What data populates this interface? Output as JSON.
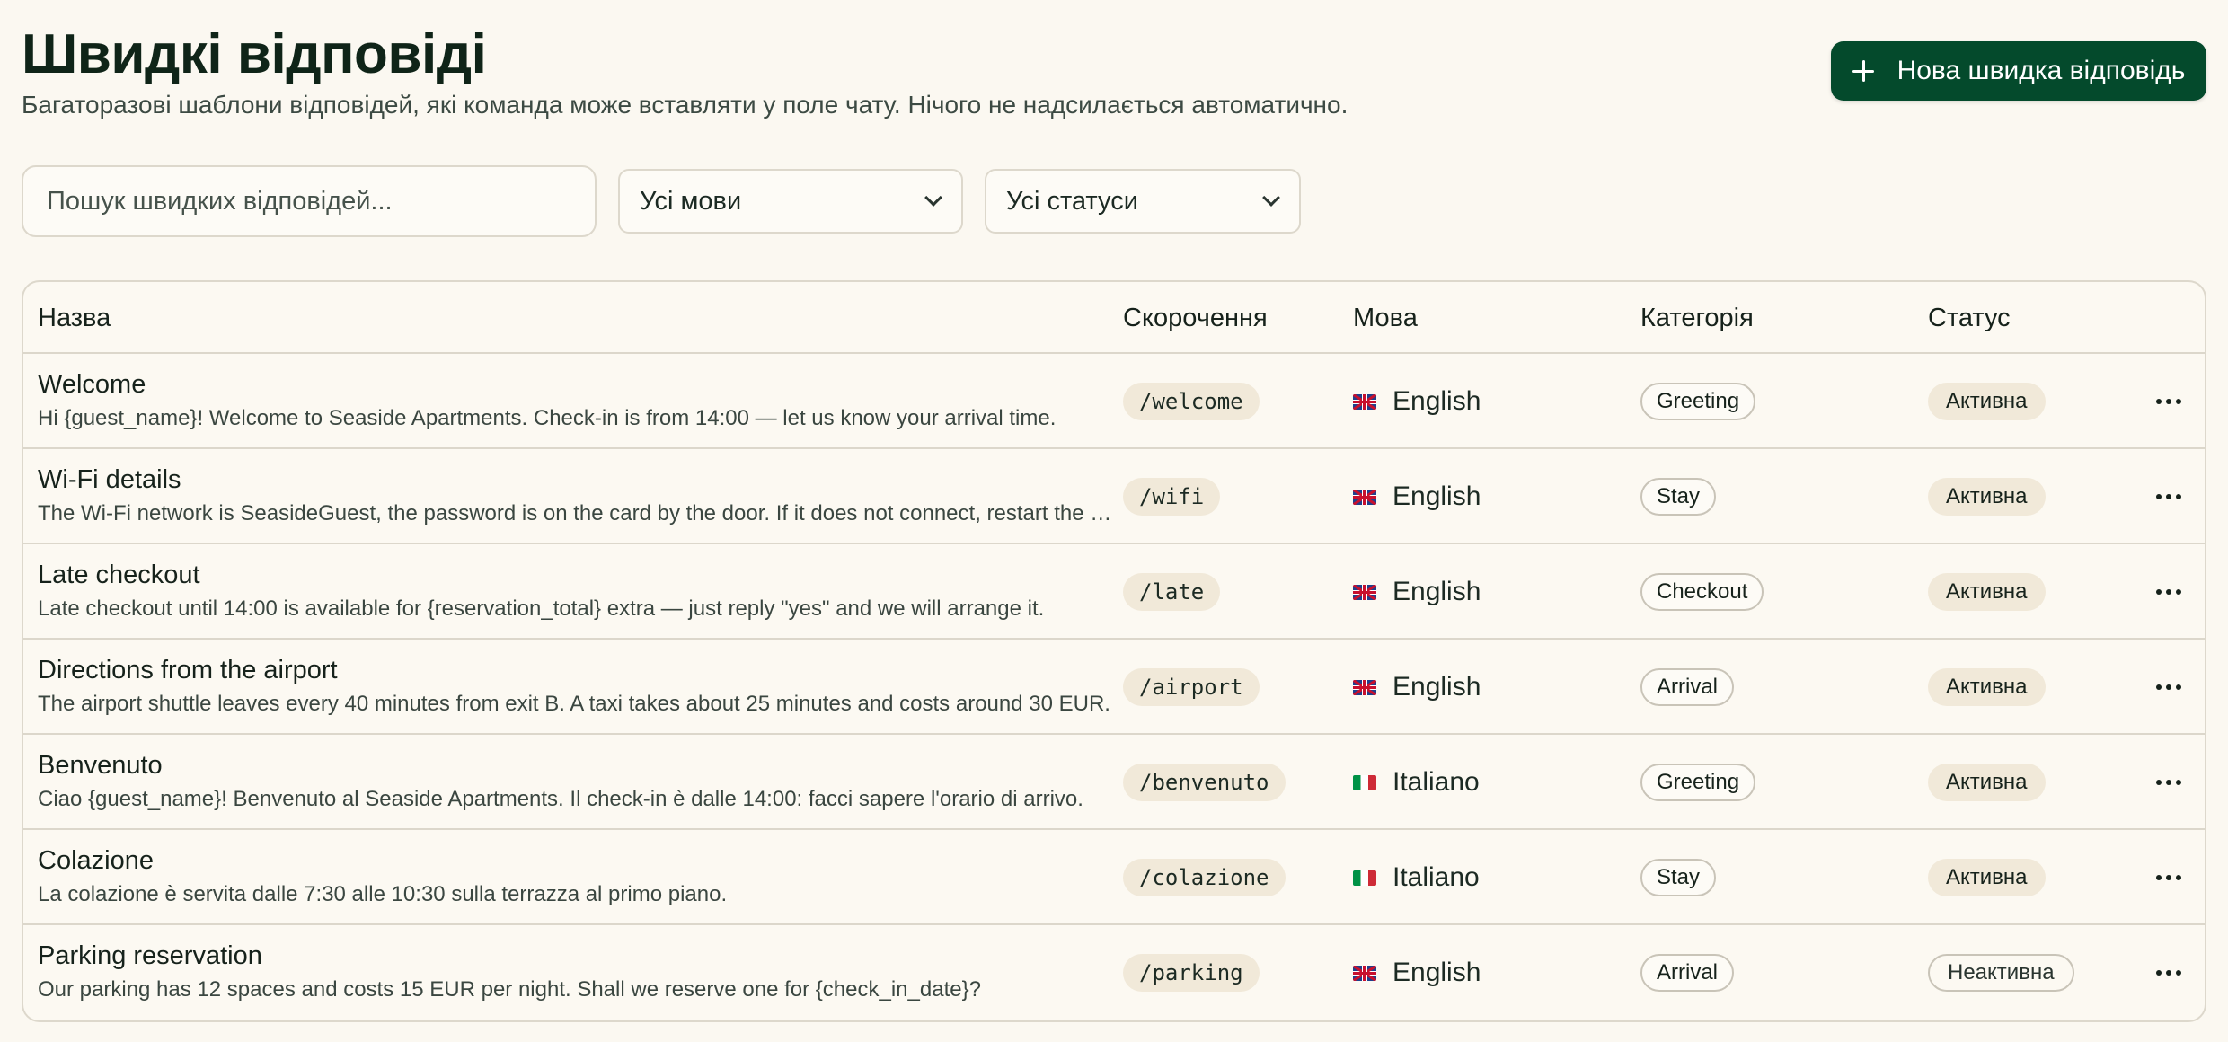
{
  "header": {
    "title": "Швидкі відповіді",
    "subtitle": "Багаторазові шаблони відповідей, які команда може вставляти у поле чату. Нічого не надсилається автоматично.",
    "new_button_label": "Нова швидка відповідь"
  },
  "filters": {
    "search_placeholder": "Пошук швидких відповідей...",
    "language_selected": "Усі мови",
    "status_selected": "Усі статуси"
  },
  "table": {
    "columns": {
      "name": "Назва",
      "shortcut": "Скорочення",
      "language": "Мова",
      "category": "Категорія",
      "status": "Статус"
    },
    "rows": [
      {
        "name": "Welcome",
        "preview": "Hi {guest_name}! Welcome to Seaside Apartments. Check-in is from 14:00 — let us know your arrival time.",
        "shortcut": "/welcome",
        "flag": "uk-flag",
        "language": "English",
        "category": "Greeting",
        "status": "Активна",
        "active": true
      },
      {
        "name": "Wi-Fi details",
        "preview": "The Wi-Fi network is SeasideGuest, the password is on the card by the door. If it does not connect, restart the router.",
        "shortcut": "/wifi",
        "flag": "uk-flag",
        "language": "English",
        "category": "Stay",
        "status": "Активна",
        "active": true
      },
      {
        "name": "Late checkout",
        "preview": "Late checkout until 14:00 is available for {reservation_total} extra — just reply \"yes\" and we will arrange it.",
        "shortcut": "/late",
        "flag": "uk-flag",
        "language": "English",
        "category": "Checkout",
        "status": "Активна",
        "active": true
      },
      {
        "name": "Directions from the airport",
        "preview": "The airport shuttle leaves every 40 minutes from exit B. A taxi takes about 25 minutes and costs around 30 EUR.",
        "shortcut": "/airport",
        "flag": "uk-flag",
        "language": "English",
        "category": "Arrival",
        "status": "Активна",
        "active": true
      },
      {
        "name": "Benvenuto",
        "preview": "Ciao {guest_name}! Benvenuto al Seaside Apartments. Il check-in è dalle 14:00: facci sapere l'orario di arrivo.",
        "shortcut": "/benvenuto",
        "flag": "it-flag",
        "language": "Italiano",
        "category": "Greeting",
        "status": "Активна",
        "active": true
      },
      {
        "name": "Colazione",
        "preview": "La colazione è servita dalle 7:30 alle 10:30 sulla terrazza al primo piano.",
        "shortcut": "/colazione",
        "flag": "it-flag",
        "language": "Italiano",
        "category": "Stay",
        "status": "Активна",
        "active": true
      },
      {
        "name": "Parking reservation",
        "preview": "Our parking has 12 spaces and costs 15 EUR per night. Shall we reserve one for {check_in_date}?",
        "shortcut": "/parking",
        "flag": "uk-flag",
        "language": "English",
        "category": "Arrival",
        "status": "Неактивна",
        "active": false
      }
    ]
  },
  "colors": {
    "background": "#fbf8f1",
    "primary_button": "#044a2c",
    "badge_fill": "#f1e9d9",
    "border": "#ddd8cc"
  }
}
